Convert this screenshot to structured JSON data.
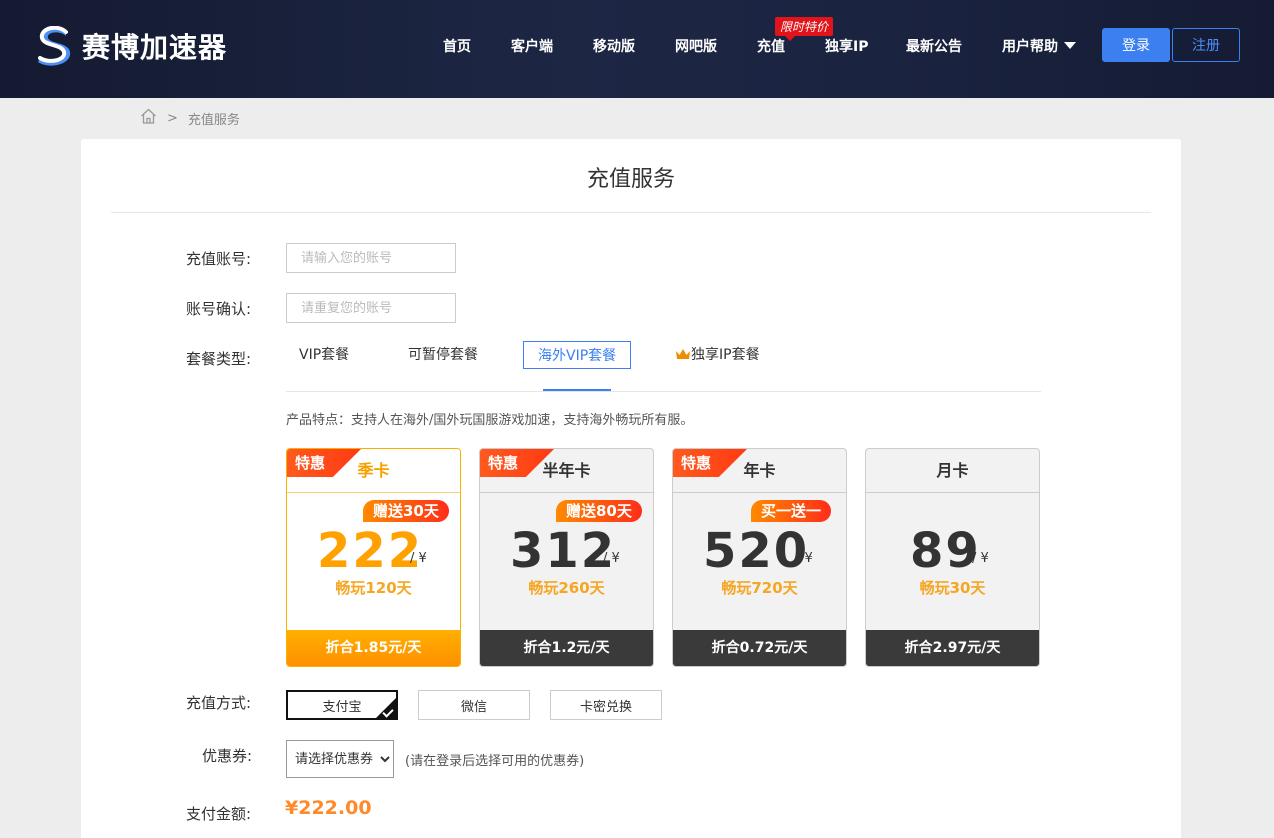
{
  "header": {
    "logo_text": "赛博加速器",
    "nav": [
      {
        "label": "首页"
      },
      {
        "label": "客户端"
      },
      {
        "label": "移动版"
      },
      {
        "label": "网吧版"
      },
      {
        "label": "充值"
      },
      {
        "label": "独享IP"
      },
      {
        "label": "最新公告"
      },
      {
        "label": "用户帮助"
      }
    ],
    "nav_badge": "限时特价",
    "login_label": "登录",
    "register_label": "注册",
    "brand_color": "#3b7ff0"
  },
  "breadcrumb": {
    "home_icon": "home-icon",
    "separator": ">",
    "current": "充值服务"
  },
  "page_title": "充值服务",
  "form": {
    "account_label": "充值账号:",
    "account_placeholder": "请输入您的账号",
    "account_value": "",
    "confirm_label": "账号确认:",
    "confirm_placeholder": "请重复您的账号",
    "confirm_value": "",
    "plan_type_label": "套餐类型:",
    "plan_tabs": [
      {
        "label": "VIP套餐",
        "active": false
      },
      {
        "label": "可暂停套餐",
        "active": false
      },
      {
        "label": "海外VIP套餐",
        "active": true
      },
      {
        "label": "独享IP套餐",
        "active": false,
        "icon": "crown-icon"
      }
    ],
    "feature_text": "产品特点：支持人在海外/国外玩国服游戏加速，支持海外畅玩所有服。",
    "cards": [
      {
        "ribbon": "特惠",
        "name": "季卡",
        "gift": "赠送30天",
        "price": "222",
        "unit": "/ ¥",
        "days": "畅玩120天",
        "per_day": "折合1.85元/天",
        "selected": true
      },
      {
        "ribbon": "特惠",
        "name": "半年卡",
        "gift": "赠送80天",
        "price": "312",
        "unit": "/ ¥",
        "days": "畅玩260天",
        "per_day": "折合1.2元/天",
        "selected": false
      },
      {
        "ribbon": "特惠",
        "name": "年卡",
        "gift": "买一送一",
        "price": "520",
        "unit": "/ ¥",
        "days": "畅玩720天",
        "per_day": "折合0.72元/天",
        "selected": false
      },
      {
        "ribbon": "",
        "name": "月卡",
        "gift": "",
        "price": "89",
        "unit": "/ ¥",
        "days": "畅玩30天",
        "per_day": "折合2.97元/天",
        "selected": false
      }
    ],
    "pay_method_label": "充值方式:",
    "pay_methods": [
      {
        "label": "支付宝",
        "active": true
      },
      {
        "label": "微信",
        "active": false
      },
      {
        "label": "卡密兑换",
        "active": false
      }
    ],
    "coupon_label": "优惠券:",
    "coupon_selected": "请选择优惠券",
    "coupon_hint": "(请在登录后选择可用的优惠券)",
    "amount_label": "支付金额:",
    "amount_value": "¥222.00"
  }
}
